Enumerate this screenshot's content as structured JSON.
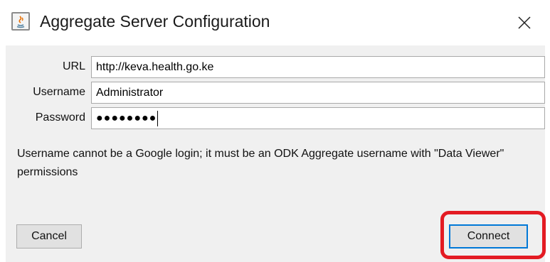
{
  "window": {
    "title": "Aggregate Server Configuration",
    "icon": "java-icon",
    "close_glyph": "✕"
  },
  "form": {
    "url": {
      "label": "URL",
      "value": "http://keva.health.go.ke"
    },
    "username": {
      "label": "Username",
      "value": "Administrator"
    },
    "password": {
      "label": "Password",
      "masked_value": "●●●●●●●●"
    }
  },
  "help_text": "Username cannot be a Google login; it must be an ODK Aggregate username with \"Data Viewer\" permissions",
  "buttons": {
    "cancel": "Cancel",
    "connect": "Connect"
  },
  "colors": {
    "panel_bg": "#f0f0f0",
    "focus_border": "#0078d7",
    "annotation_red": "#e31b23"
  }
}
